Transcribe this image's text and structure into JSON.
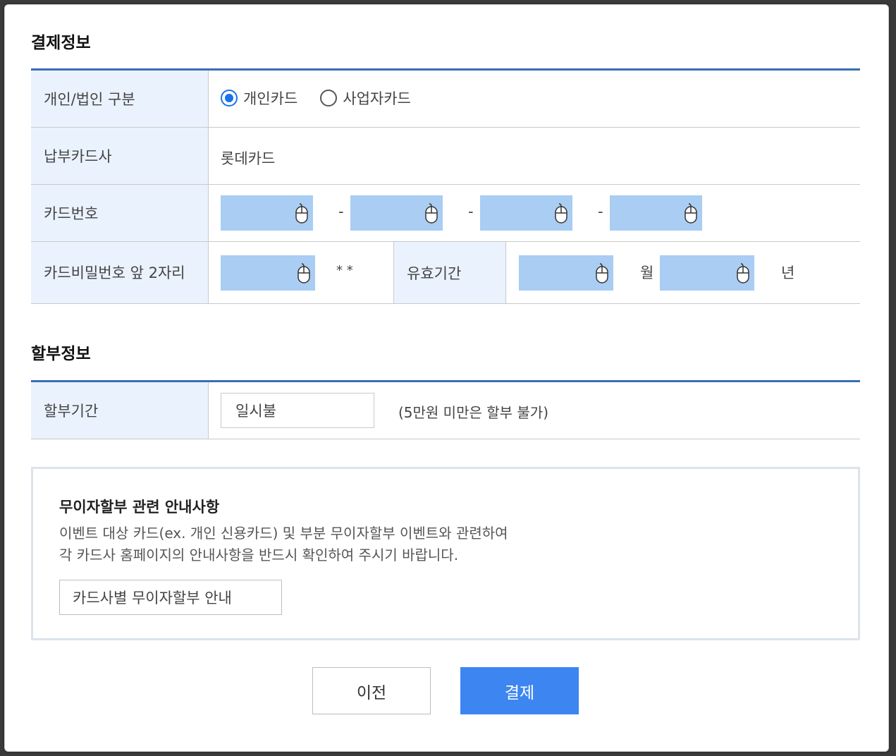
{
  "payment_section": {
    "title": "결제정보",
    "type_label": "개인/법인 구분",
    "type_options": [
      {
        "label": "개인카드",
        "checked": true
      },
      {
        "label": "사업자카드",
        "checked": false
      }
    ],
    "issuer_label": "납부카드사",
    "issuer_value": "롯데카드",
    "card_number_label": "카드번호",
    "card_number_separator": "-",
    "password_label": "카드비밀번호 앞 2자리",
    "password_mask": "* *",
    "expiry_label": "유효기간",
    "expiry_month_unit": "월",
    "expiry_year_unit": "년"
  },
  "installment_section": {
    "title": "할부정보",
    "period_label": "할부기간",
    "period_value": "일시불",
    "period_note": "(5만원 미만은 할부 불가)"
  },
  "notice": {
    "title": "무이자할부 관련 안내사항",
    "line1": "이벤트 대상 카드(ex. 개인 신용카드) 및 부분 무이자할부 이벤트와 관련하여",
    "line2": "각 카드사 홈페이지의 안내사항을 반드시 확인하여 주시기 바랍니다.",
    "button_label": "카드사별 무이자할부 안내"
  },
  "actions": {
    "prev_label": "이전",
    "pay_label": "결제"
  },
  "colors": {
    "accent": "#3d85f0",
    "table_border": "#3a6db5",
    "header_bg": "#eaf2fd",
    "secure_input_bg": "#a9cdf3"
  },
  "icons": {
    "secure_input": "mouse-icon"
  }
}
